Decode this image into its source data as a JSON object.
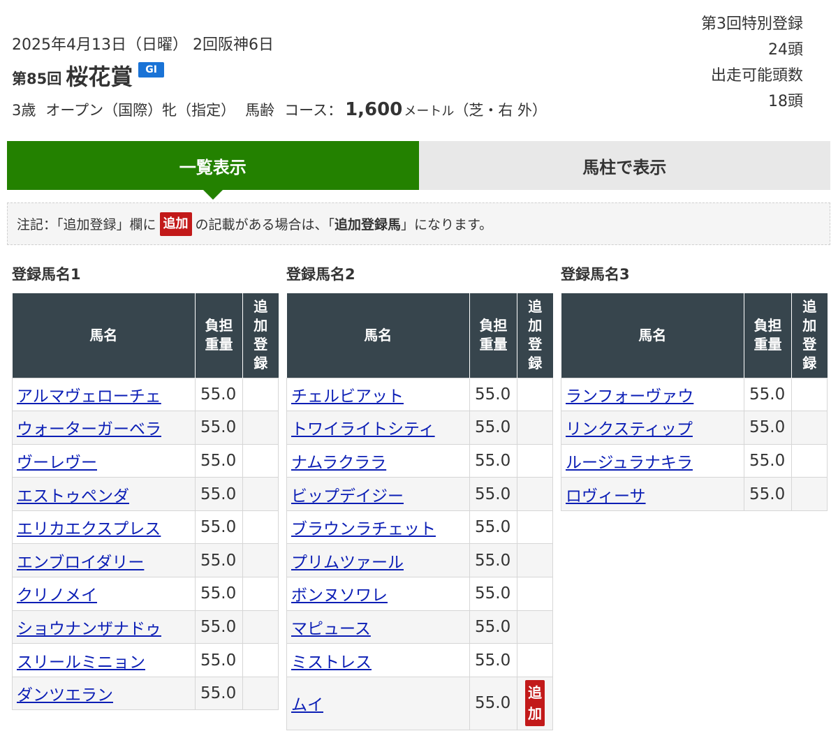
{
  "header": {
    "date": "2025年4月13日（日曜） 2回阪神6日",
    "kai": "第85回",
    "race_name": "桜花賞",
    "grade": "GI",
    "cond_age": "3歳",
    "cond_class": "オープン（国際）牝（指定）",
    "cond_weight": "馬齢",
    "course_label": "コース：",
    "distance": "1,600",
    "distance_unit": "メートル",
    "course_type": "（芝・右 外）"
  },
  "summary": {
    "reg_label": "第3回特別登録",
    "reg_count": "24頭",
    "eligible_label": "出走可能頭数",
    "eligible_count": "18頭"
  },
  "tabs": [
    {
      "label": "一覧表示",
      "active": true
    },
    {
      "label": "馬柱で表示",
      "active": false
    }
  ],
  "notice": {
    "prefix": "注記：「追加登録」欄に",
    "badge": "追加",
    "middle": "の記載がある場合は、「",
    "bold": "追加登録馬",
    "suffix": "」になります。"
  },
  "table_headers": {
    "name": "馬名",
    "weight_l1": "負担",
    "weight_l2": "重量",
    "add_l1": "追",
    "add_l2": "加",
    "add_l3": "登",
    "add_l4": "録"
  },
  "columns": [
    {
      "title": "登録馬名1",
      "rows": [
        {
          "name": "アルマヴェローチェ",
          "weight": "55.0",
          "add": ""
        },
        {
          "name": "ウォーターガーベラ",
          "weight": "55.0",
          "add": ""
        },
        {
          "name": "ヴーレヴー",
          "weight": "55.0",
          "add": ""
        },
        {
          "name": "エストゥペンダ",
          "weight": "55.0",
          "add": ""
        },
        {
          "name": "エリカエクスプレス",
          "weight": "55.0",
          "add": ""
        },
        {
          "name": "エンブロイダリー",
          "weight": "55.0",
          "add": ""
        },
        {
          "name": "クリノメイ",
          "weight": "55.0",
          "add": ""
        },
        {
          "name": "ショウナンザナドゥ",
          "weight": "55.0",
          "add": ""
        },
        {
          "name": "スリールミニョン",
          "weight": "55.0",
          "add": ""
        },
        {
          "name": "ダンツエラン",
          "weight": "55.0",
          "add": ""
        }
      ]
    },
    {
      "title": "登録馬名2",
      "rows": [
        {
          "name": "チェルビアット",
          "weight": "55.0",
          "add": ""
        },
        {
          "name": "トワイライトシティ",
          "weight": "55.0",
          "add": ""
        },
        {
          "name": "ナムラクララ",
          "weight": "55.0",
          "add": ""
        },
        {
          "name": "ビップデイジー",
          "weight": "55.0",
          "add": ""
        },
        {
          "name": "ブラウンラチェット",
          "weight": "55.0",
          "add": ""
        },
        {
          "name": "プリムツァール",
          "weight": "55.0",
          "add": ""
        },
        {
          "name": "ボンヌソワレ",
          "weight": "55.0",
          "add": ""
        },
        {
          "name": "マピュース",
          "weight": "55.0",
          "add": ""
        },
        {
          "name": "ミストレス",
          "weight": "55.0",
          "add": ""
        },
        {
          "name": "ムイ",
          "weight": "55.0",
          "add": "追加"
        }
      ]
    },
    {
      "title": "登録馬名3",
      "rows": [
        {
          "name": "ランフォーヴァウ",
          "weight": "55.0",
          "add": ""
        },
        {
          "name": "リンクスティップ",
          "weight": "55.0",
          "add": ""
        },
        {
          "name": "ルージュラナキラ",
          "weight": "55.0",
          "add": ""
        },
        {
          "name": "ロヴィーサ",
          "weight": "55.0",
          "add": ""
        }
      ]
    }
  ],
  "colors": {
    "tab_active": "#238100",
    "tab_inactive": "#e8e8e8",
    "table_header": "#37454d",
    "grade_badge": "#1a73d6",
    "add_badge": "#c21a1a",
    "link": "#0b1eb5"
  }
}
